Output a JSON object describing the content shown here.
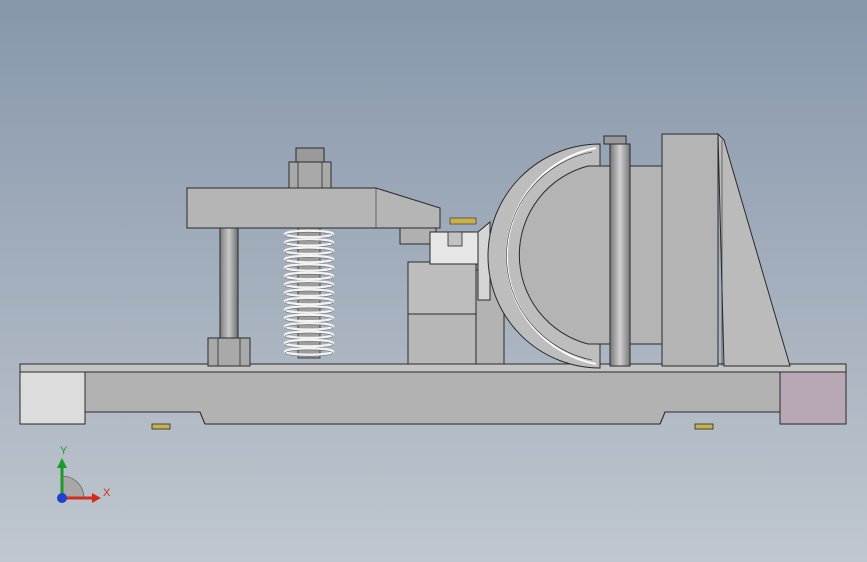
{
  "viewport": {
    "background_top": "#8797ab",
    "background_bottom": "#c0c7cf"
  },
  "model": {
    "part_color": "#b9b9b9",
    "edge_color": "#2a2a2a",
    "highlight_end_left": "#dcdcdc",
    "highlight_end_right": "#b8a8b5"
  },
  "triad": {
    "x_label": "X",
    "y_label": "Y",
    "x_color": "#d52b1e",
    "y_color": "#1e9a2a",
    "z_color": "#1f3fd6"
  }
}
